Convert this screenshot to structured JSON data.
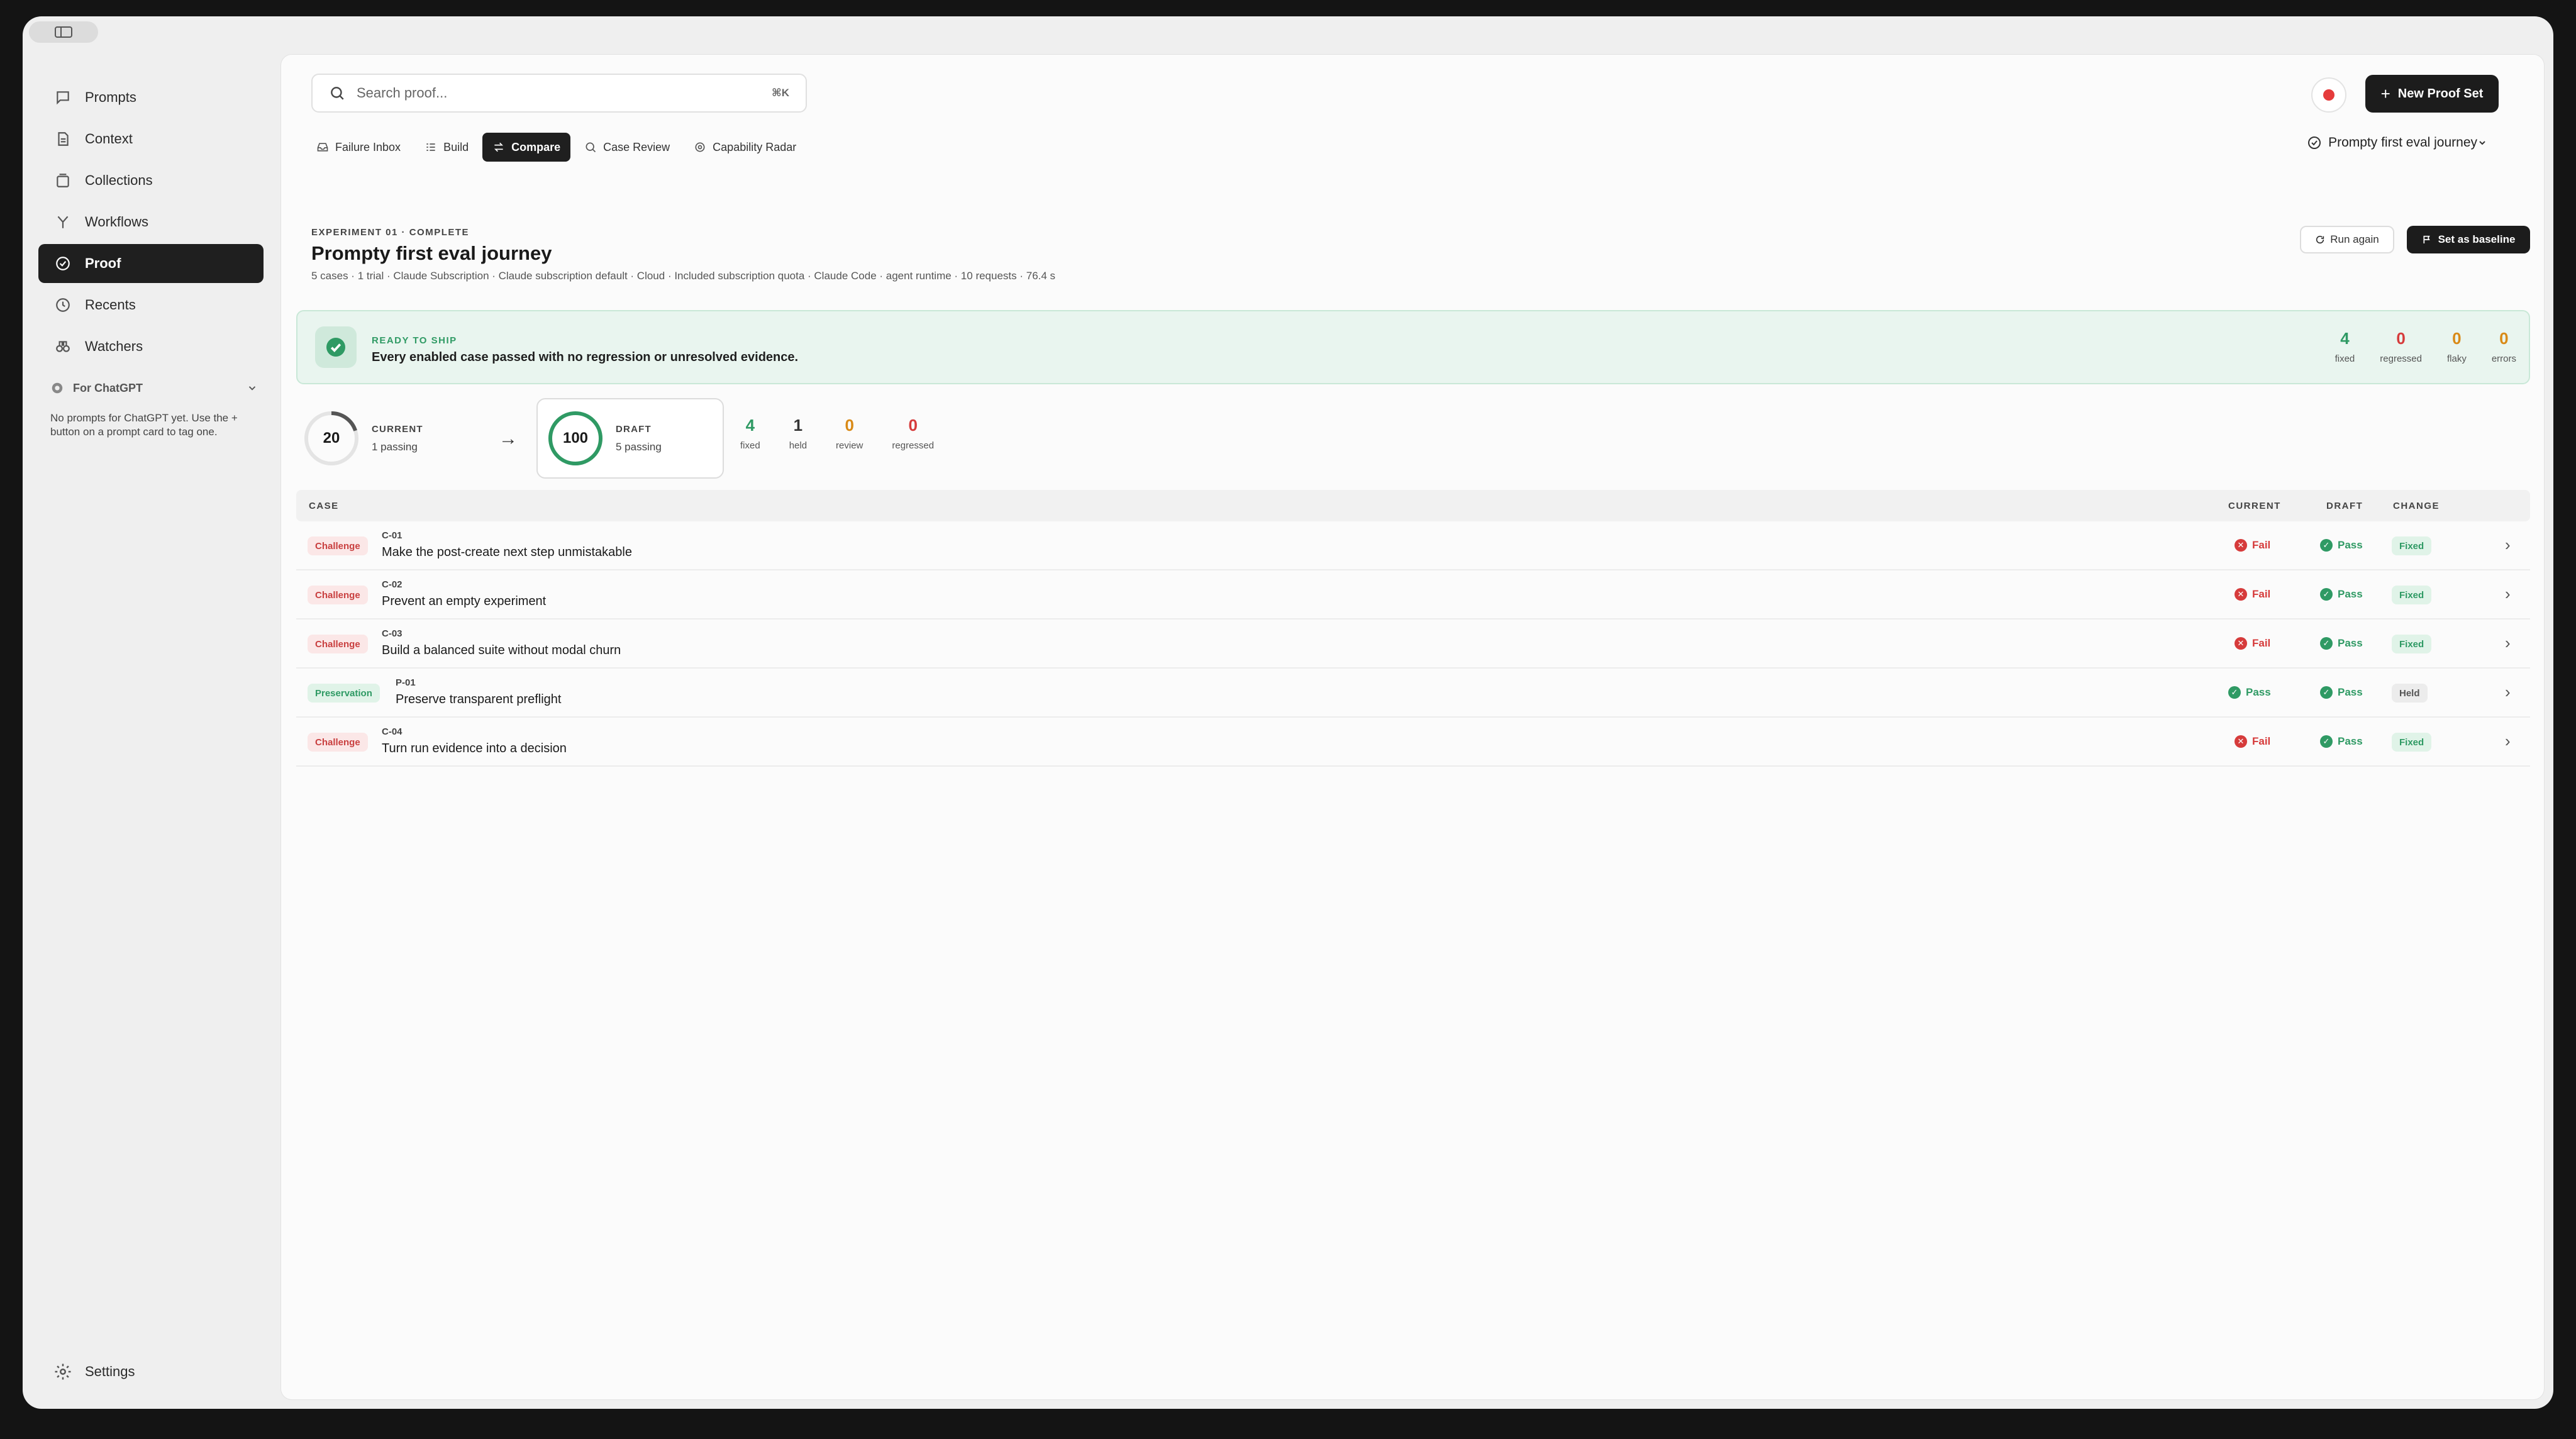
{
  "sidebar": {
    "items": [
      {
        "label": "Prompts",
        "icon": "chat-icon"
      },
      {
        "label": "Context",
        "icon": "document-icon"
      },
      {
        "label": "Collections",
        "icon": "collection-icon"
      },
      {
        "label": "Workflows",
        "icon": "workflow-icon"
      },
      {
        "label": "Proof",
        "icon": "proof-icon",
        "active": true
      },
      {
        "label": "Recents",
        "icon": "clock-icon"
      },
      {
        "label": "Watchers",
        "icon": "binoculars-icon"
      }
    ],
    "section_title": "For ChatGPT",
    "section_empty": "No prompts for ChatGPT yet. Use the + button on a prompt card to tag one.",
    "settings_label": "Settings"
  },
  "header": {
    "search_placeholder": "Search proof...",
    "search_shortcut": "⌘K",
    "new_button": "New Proof Set"
  },
  "tabs": [
    {
      "label": "Failure Inbox",
      "active": false
    },
    {
      "label": "Build",
      "active": false
    },
    {
      "label": "Compare",
      "active": true
    },
    {
      "label": "Case Review",
      "active": false
    },
    {
      "label": "Capability Radar",
      "active": false
    }
  ],
  "proof_set_selector": "Prompty first eval journey",
  "experiment": {
    "label": "EXPERIMENT 01 · COMPLETE",
    "title": "Prompty first eval journey",
    "meta": "5 cases · 1 trial · Claude Subscription · Claude subscription default · Cloud · Included subscription quota · Claude Code · agent runtime · 10 requests · 76.4 s",
    "run_again": "Run again",
    "set_baseline": "Set as baseline"
  },
  "banner": {
    "label": "READY TO SHIP",
    "text": "Every enabled case passed with no regression or unresolved evidence.",
    "stats": [
      {
        "value": "4",
        "label": "fixed",
        "color": "#2f9a64"
      },
      {
        "value": "0",
        "label": "regressed",
        "color": "#d63b3b"
      },
      {
        "value": "0",
        "label": "flaky",
        "color": "#d98a17"
      },
      {
        "value": "0",
        "label": "errors",
        "color": "#d98a17"
      }
    ]
  },
  "scores": {
    "current": {
      "value": "20",
      "fraction": 0.2,
      "label": "CURRENT",
      "sub": "1 passing"
    },
    "draft": {
      "value": "100",
      "fraction": 1.0,
      "label": "DRAFT",
      "sub": "5 passing"
    },
    "stats": [
      {
        "value": "4",
        "label": "fixed",
        "color": "#2f9a64"
      },
      {
        "value": "1",
        "label": "held",
        "color": "#333333"
      },
      {
        "value": "0",
        "label": "review",
        "color": "#d98a17"
      },
      {
        "value": "0",
        "label": "regressed",
        "color": "#d63b3b"
      }
    ]
  },
  "table": {
    "headers": {
      "case": "CASE",
      "current": "CURRENT",
      "draft": "DRAFT",
      "change": "CHANGE"
    },
    "rows": [
      {
        "type": "Challenge",
        "id": "C-01",
        "title": "Make the post-create next step unmistakable",
        "current": "Fail",
        "draft": "Pass",
        "change": "Fixed"
      },
      {
        "type": "Challenge",
        "id": "C-02",
        "title": "Prevent an empty experiment",
        "current": "Fail",
        "draft": "Pass",
        "change": "Fixed"
      },
      {
        "type": "Challenge",
        "id": "C-03",
        "title": "Build a balanced suite without modal churn",
        "current": "Fail",
        "draft": "Pass",
        "change": "Fixed"
      },
      {
        "type": "Preservation",
        "id": "P-01",
        "title": "Preserve transparent preflight",
        "current": "Pass",
        "draft": "Pass",
        "change": "Held"
      },
      {
        "type": "Challenge",
        "id": "C-04",
        "title": "Turn run evidence into a decision",
        "current": "Fail",
        "draft": "Pass",
        "change": "Fixed"
      }
    ]
  }
}
